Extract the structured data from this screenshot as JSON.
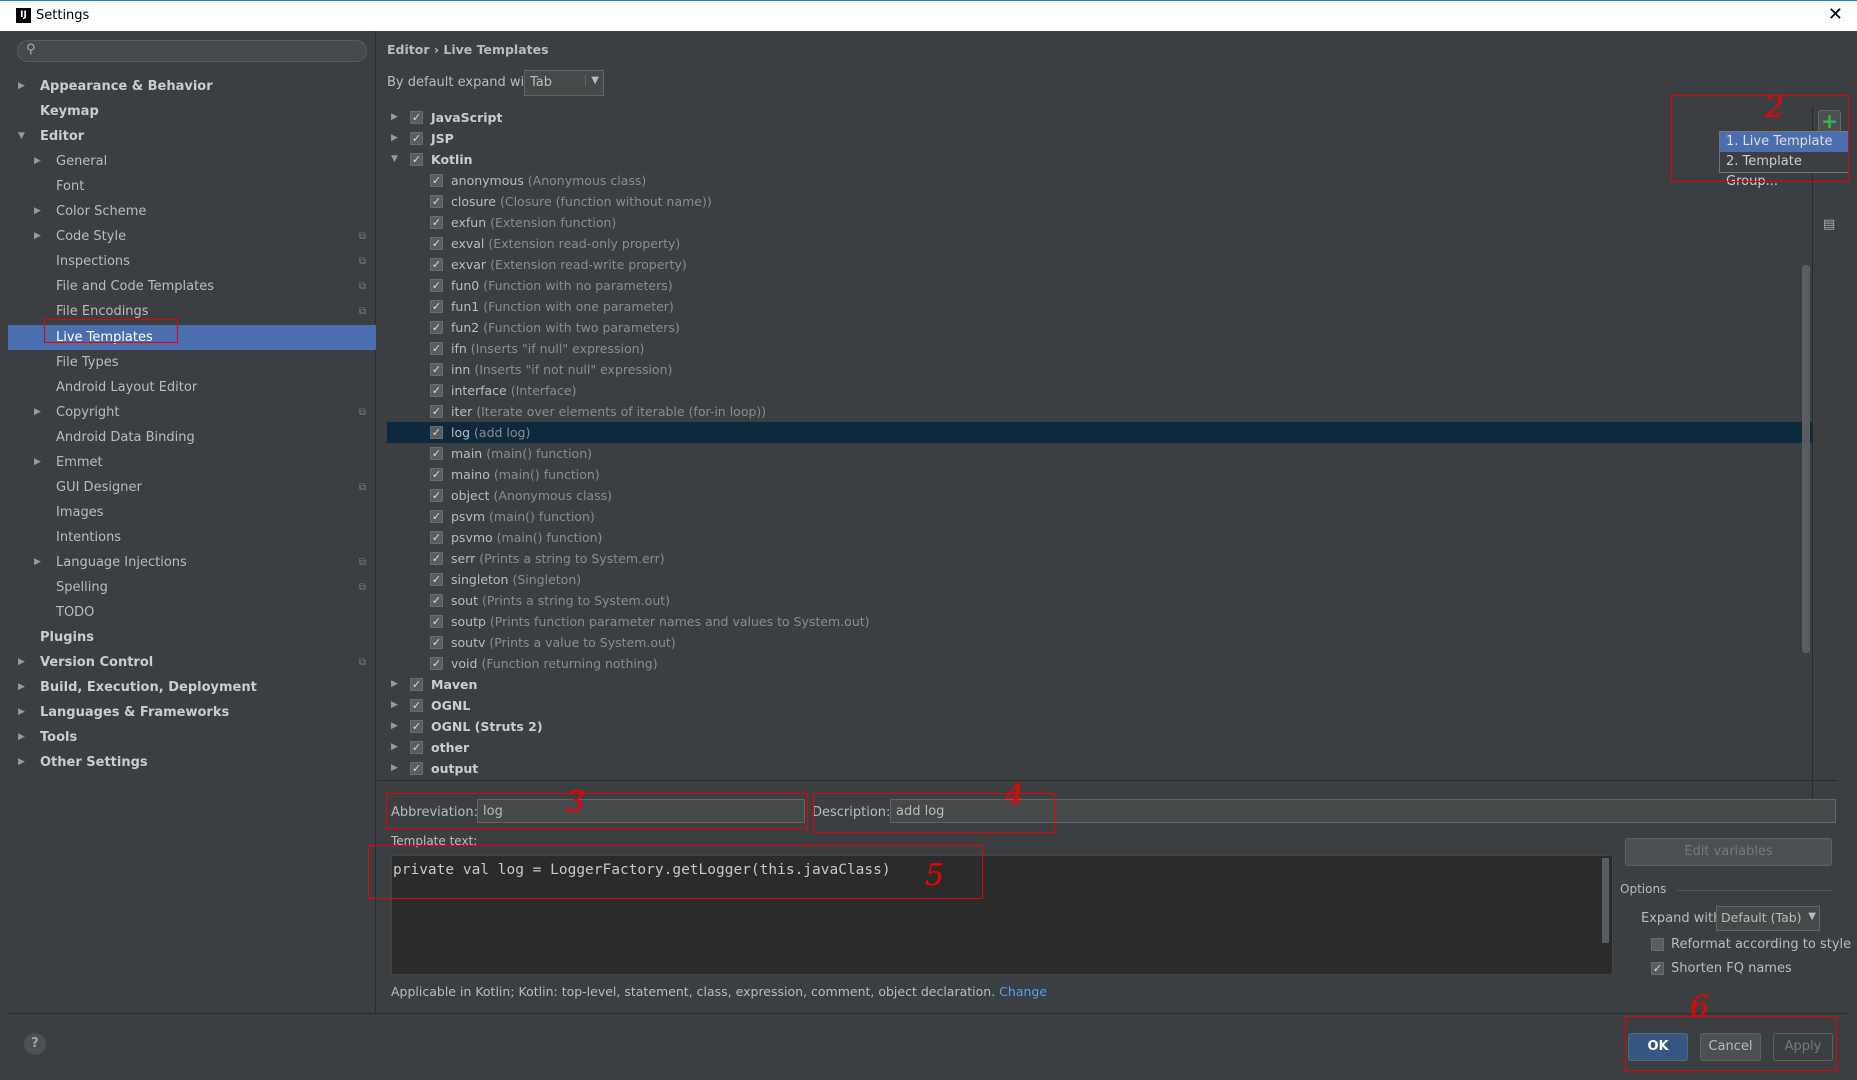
{
  "window": {
    "title": "Settings",
    "close": "✕"
  },
  "search": {
    "icon": "search-icon",
    "placeholder": ""
  },
  "sidebar": {
    "items": [
      {
        "label": "Appearance & Behavior",
        "level": 0,
        "arrow": "▶",
        "bold": true
      },
      {
        "label": "Keymap",
        "level": 0,
        "bold": true
      },
      {
        "label": "Editor",
        "level": 0,
        "arrow": "▼",
        "bold": true
      },
      {
        "label": "General",
        "level": 1,
        "arrow": "▶"
      },
      {
        "label": "Font",
        "level": 1
      },
      {
        "label": "Color Scheme",
        "level": 1,
        "arrow": "▶"
      },
      {
        "label": "Code Style",
        "level": 1,
        "arrow": "▶",
        "copy": true
      },
      {
        "label": "Inspections",
        "level": 1,
        "copy": true
      },
      {
        "label": "File and Code Templates",
        "level": 1,
        "copy": true
      },
      {
        "label": "File Encodings",
        "level": 1,
        "copy": true
      },
      {
        "label": "Live Templates",
        "level": 1,
        "selected": true
      },
      {
        "label": "File Types",
        "level": 1
      },
      {
        "label": "Android Layout Editor",
        "level": 1
      },
      {
        "label": "Copyright",
        "level": 1,
        "arrow": "▶",
        "copy": true
      },
      {
        "label": "Android Data Binding",
        "level": 1
      },
      {
        "label": "Emmet",
        "level": 1,
        "arrow": "▶"
      },
      {
        "label": "GUI Designer",
        "level": 1,
        "copy": true
      },
      {
        "label": "Images",
        "level": 1
      },
      {
        "label": "Intentions",
        "level": 1
      },
      {
        "label": "Language Injections",
        "level": 1,
        "arrow": "▶",
        "copy": true
      },
      {
        "label": "Spelling",
        "level": 1,
        "copy": true
      },
      {
        "label": "TODO",
        "level": 1
      },
      {
        "label": "Plugins",
        "level": 0,
        "bold": true
      },
      {
        "label": "Version Control",
        "level": 0,
        "arrow": "▶",
        "bold": true,
        "copy": true
      },
      {
        "label": "Build, Execution, Deployment",
        "level": 0,
        "arrow": "▶",
        "bold": true
      },
      {
        "label": "Languages & Frameworks",
        "level": 0,
        "arrow": "▶",
        "bold": true
      },
      {
        "label": "Tools",
        "level": 0,
        "arrow": "▶",
        "bold": true
      },
      {
        "label": "Other Settings",
        "level": 0,
        "arrow": "▶",
        "bold": true
      }
    ]
  },
  "breadcrumb": {
    "parent": "Editor",
    "sep": "›",
    "current": "Live Templates"
  },
  "expand": {
    "label": "By default expand with",
    "value": "Tab"
  },
  "tree": [
    {
      "group": "JavaScript",
      "arrow": "▶"
    },
    {
      "group": "JSP",
      "arrow": "▶"
    },
    {
      "group": "Kotlin",
      "arrow": "▼"
    },
    {
      "name": "anonymous",
      "desc": "(Anonymous class)"
    },
    {
      "name": "closure",
      "desc": "(Closure (function without name))"
    },
    {
      "name": "exfun",
      "desc": "(Extension function)"
    },
    {
      "name": "exval",
      "desc": "(Extension read-only property)"
    },
    {
      "name": "exvar",
      "desc": "(Extension read-write property)"
    },
    {
      "name": "fun0",
      "desc": "(Function with no parameters)"
    },
    {
      "name": "fun1",
      "desc": "(Function with one parameter)"
    },
    {
      "name": "fun2",
      "desc": "(Function with two parameters)"
    },
    {
      "name": "ifn",
      "desc": "(Inserts \"if null\" expression)"
    },
    {
      "name": "inn",
      "desc": "(Inserts \"if not null\" expression)"
    },
    {
      "name": "interface",
      "desc": "(Interface)"
    },
    {
      "name": "iter",
      "desc": "(Iterate over elements of iterable (for-in loop))"
    },
    {
      "name": "log",
      "desc": "(add log)",
      "selected": true
    },
    {
      "name": "main",
      "desc": "(main() function)"
    },
    {
      "name": "maino",
      "desc": "(main() function)"
    },
    {
      "name": "object",
      "desc": "(Anonymous class)"
    },
    {
      "name": "psvm",
      "desc": "(main() function)"
    },
    {
      "name": "psvmo",
      "desc": "(main() function)"
    },
    {
      "name": "serr",
      "desc": "(Prints a string to System.err)"
    },
    {
      "name": "singleton",
      "desc": "(Singleton)"
    },
    {
      "name": "sout",
      "desc": "(Prints a string to System.out)"
    },
    {
      "name": "soutp",
      "desc": "(Prints function parameter names and values to System.out)"
    },
    {
      "name": "soutv",
      "desc": "(Prints a value to System.out)"
    },
    {
      "name": "void",
      "desc": "(Function returning nothing)"
    },
    {
      "group": "Maven",
      "arrow": "▶"
    },
    {
      "group": "OGNL",
      "arrow": "▶"
    },
    {
      "group": "OGNL (Struts 2)",
      "arrow": "▶"
    },
    {
      "group": "other",
      "arrow": "▶"
    },
    {
      "group": "output",
      "arrow": "▶"
    }
  ],
  "add_menu": {
    "items": [
      "1. Live Template",
      "2. Template Group..."
    ]
  },
  "editor": {
    "abbrev_label": "Abbreviation:",
    "abbrev": "log",
    "desc_label": "Description:",
    "desc": "add log",
    "template_label": "Template text:",
    "template": "private val log = LoggerFactory.getLogger(this.javaClass)",
    "edit_vars": "Edit variables",
    "options": "Options",
    "expand_label": "Expand with",
    "expand_value": "Default (Tab)",
    "reformat": "Reformat according to style",
    "reformat_checked": false,
    "shorten": "Shorten FQ names",
    "shorten_checked": true,
    "applicable": "Applicable in Kotlin; Kotlin: top-level, statement, class, expression, comment, object declaration.",
    "change": "Change"
  },
  "buttons": {
    "ok": "OK",
    "cancel": "Cancel",
    "apply": "Apply",
    "help": "?"
  },
  "annotations": [
    "2",
    "3",
    "4",
    "5",
    "6"
  ],
  "colors": {
    "selection": "#4b6eaf",
    "tree_selection": "#0d293e",
    "link": "#589df6",
    "annotation": "#ee0000"
  }
}
